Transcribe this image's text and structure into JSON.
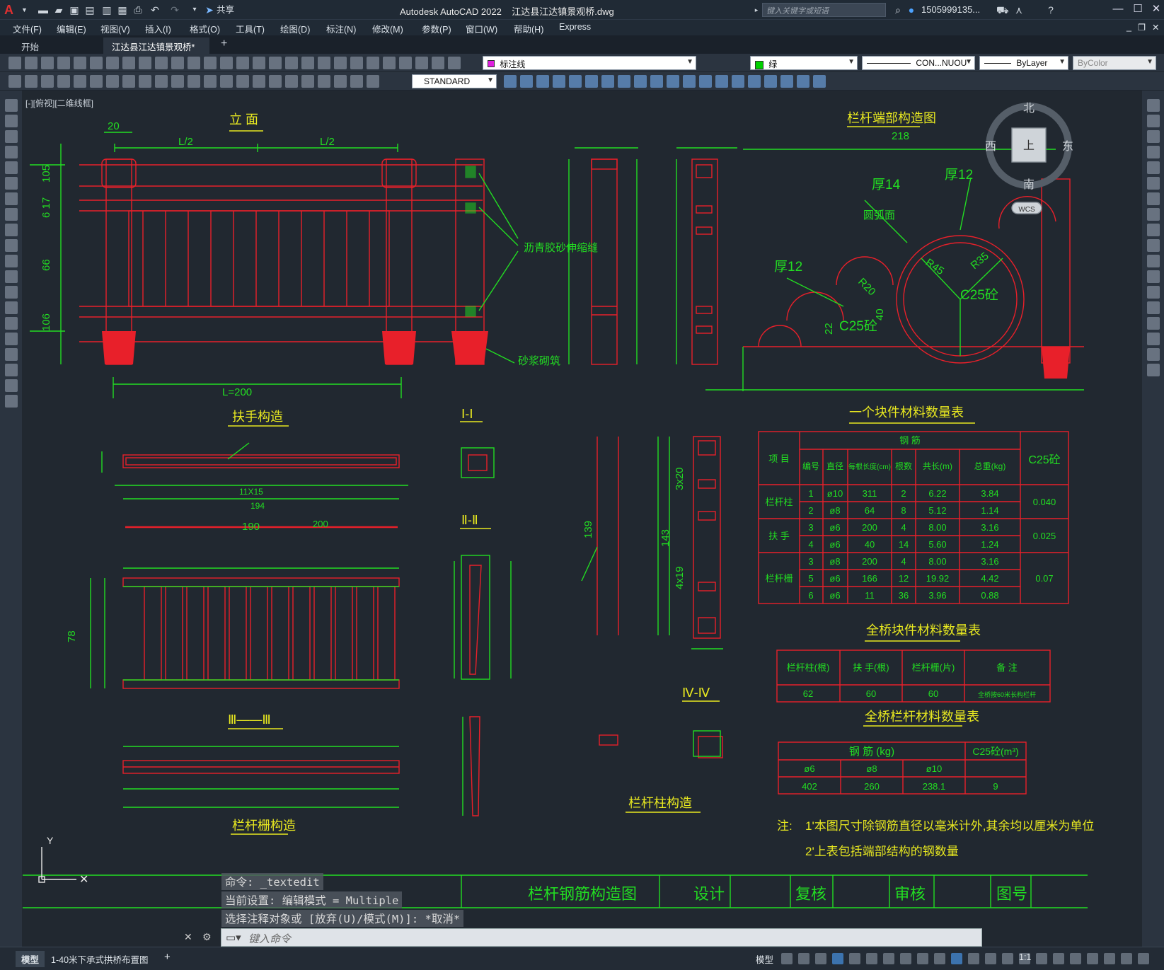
{
  "app": {
    "title": "Autodesk AutoCAD 2022    江达县江达镇景观桥.dwg",
    "search_placeholder": "键入关键字或短语",
    "user": "1505999135...",
    "share": "共享"
  },
  "menu": [
    "文件(F)",
    "编辑(E)",
    "视图(V)",
    "插入(I)",
    "格式(O)",
    "工具(T)",
    "绘图(D)",
    "标注(N)",
    "修改(M)",
    "参数(P)",
    "窗口(W)",
    "帮助(H)",
    "Express"
  ],
  "doc_tabs": {
    "start": "开始",
    "active": "江达县江达镇景观桥*"
  },
  "toolbar": {
    "layer": "标注线",
    "color": "绿",
    "linetype": "CON...NUOU",
    "lineweight": "ByLayer",
    "plotstyle": "ByColor",
    "textstyle": "STANDARD"
  },
  "viewport_label": "[-][俯视][二维线框]",
  "viewcube": {
    "north": "北",
    "south": "南",
    "east": "东",
    "west": "西",
    "top": "上",
    "wcs": "WCS"
  },
  "drawing": {
    "titles": {
      "elevation": "立 面",
      "end_detail": "栏杆端部构造图",
      "handrail": "扶手构造",
      "sec1": "Ⅰ-Ⅰ",
      "sec2": "Ⅱ-Ⅱ",
      "sec3": "Ⅲ——Ⅲ",
      "sec4": "Ⅳ-Ⅳ",
      "railing": "栏杆栅构造",
      "post": "栏杆柱构造",
      "tbl1": "一个块件材料数量表",
      "tbl2": "全桥块件材料数量表",
      "tbl3": "全桥栏杆材料数量表"
    },
    "labels": {
      "joint": "沥青胶砂伸缩缝",
      "mortar": "砂浆砌筑",
      "arcface": "圆弧面",
      "thick14": "厚14",
      "thick12a": "厚12",
      "thick12b": "厚12",
      "c25a": "C25砼",
      "c25b": "C25砼",
      "L200": "L=200",
      "Lhalf1": "L/2",
      "Lhalf2": "L/2"
    },
    "dims": {
      "d20": "20",
      "d105": "105",
      "d17": "6 17",
      "d66": "66",
      "d106": "106",
      "d218": "218",
      "r45": "R45",
      "r35": "R35",
      "r20": "R20",
      "d40": "40",
      "d22": "22",
      "d194": "194",
      "d11x15": "11X15",
      "d190": "190",
      "d200": "200",
      "d139": "139",
      "d143": "143",
      "d3x20": "3x20",
      "d4x19": "4x19",
      "d78": "78"
    },
    "table1": {
      "h_item": "项 目",
      "h_steel": "钢 筋",
      "h_c25": "C25砼",
      "h_cols": [
        "编号",
        "直径",
        "每根长度(cm)",
        "根数",
        "共长(m)",
        "总重(kg)"
      ],
      "groups": [
        "栏杆柱",
        "扶 手",
        "栏杆栅"
      ],
      "rows": [
        [
          "1",
          "ø10",
          "311",
          "2",
          "6.22",
          "3.84"
        ],
        [
          "2",
          "ø8",
          "64",
          "8",
          "5.12",
          "1.14"
        ],
        [
          "3",
          "ø6",
          "200",
          "4",
          "8.00",
          "3.16"
        ],
        [
          "4",
          "ø6",
          "40",
          "14",
          "5.60",
          "1.24"
        ],
        [
          "3",
          "ø8",
          "200",
          "4",
          "8.00",
          "3.16"
        ],
        [
          "5",
          "ø6",
          "166",
          "12",
          "19.92",
          "4.42"
        ],
        [
          "6",
          "ø6",
          "11",
          "36",
          "3.96",
          "0.88"
        ]
      ],
      "c25": [
        "0.040",
        "0.025",
        "0.07"
      ]
    },
    "table2": {
      "headers": [
        "栏杆柱(根)",
        "扶 手(根)",
        "栏杆栅(片)",
        "备 注"
      ],
      "values": [
        "62",
        "60",
        "60",
        "全桥按60米长构栏杆"
      ]
    },
    "table3": {
      "h_steel": "钢 筋 (kg)",
      "h_c25": "C25砼(m³)",
      "sub": [
        "ø6",
        "ø8",
        "ø10"
      ],
      "values": [
        "402",
        "260",
        "238.1",
        "9"
      ]
    },
    "notes": {
      "prefix": "注:",
      "n1": "1'本图尺寸除钢筋直径以毫米计外,其余均以厘米为单位",
      "n2": "2'上表包括端部结构的钢数量"
    },
    "titleblock": {
      "name": "栏杆钢筋构造图",
      "design": "设计",
      "review": "复核",
      "approve": "审核",
      "drawing_no": "图号"
    }
  },
  "command": {
    "line1": "命令: _textedit",
    "line2": "当前设置: 编辑模式 = Multiple",
    "line3": "选择注释对象或 [放弃(U)/模式(M)]: *取消*",
    "placeholder": "键入命令"
  },
  "status": {
    "model_tab": "模型",
    "layout_tab": "1-40米下承式拱桥布置图",
    "space": "模型",
    "scale": "1:1"
  },
  "colors": {
    "accent": "#4da3ff",
    "cad_red": "#e8202a",
    "cad_green": "#22dd22",
    "cad_yellow": "#e8e820"
  }
}
